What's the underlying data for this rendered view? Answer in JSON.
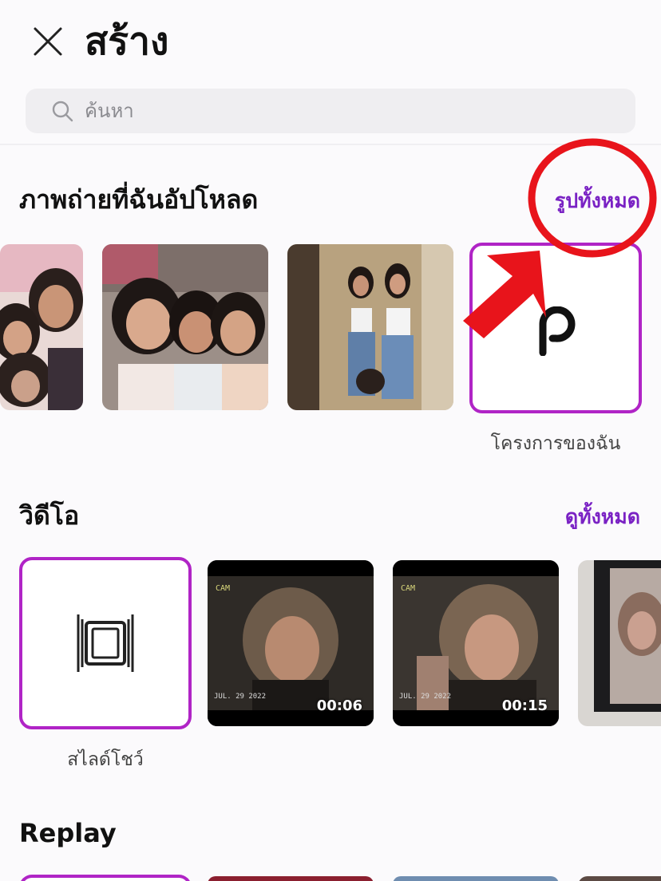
{
  "header": {
    "title": "สร้าง"
  },
  "search": {
    "placeholder": "ค้นหา"
  },
  "photos": {
    "title": "ภาพถ่ายที่ฉันอัปโหลด",
    "see_all": "รูปทั้งหมด",
    "project_tile": {
      "logo": "p",
      "caption": "โครงการของฉัน"
    }
  },
  "videos": {
    "title": "วิดีโอ",
    "see_all": "ดูทั้งหมด",
    "slideshow_caption": "สไลด์โชว์",
    "items": [
      {
        "duration": "00:06",
        "cam_text": "CAM",
        "date_text": "JUL. 29 2022"
      },
      {
        "duration": "00:15",
        "cam_text": "CAM",
        "date_text": "JUL. 29 2022"
      }
    ]
  },
  "replay": {
    "title": "Replay"
  },
  "colors": {
    "accent": "#7a22c4",
    "tile_border": "#b024c6",
    "annotation_red": "#e8141b"
  },
  "icons": [
    "close-icon",
    "search-icon",
    "slideshow-icon",
    "project-logo"
  ]
}
